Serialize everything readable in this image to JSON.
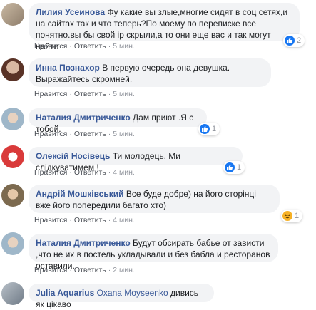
{
  "actions": {
    "like": "Нравится",
    "reply": "Ответить",
    "sep": "·"
  },
  "comments": [
    {
      "author": "Лилия Усеинова",
      "text": "Фу какие вы злые,многие сидят в соц сетях,и на сайтах так и что теперь?По моему по переписке все понятно.вы бы свой ip скрыли,а то они еще вас и так могут найти",
      "time": "5 мин.",
      "reaction": {
        "type": "like",
        "count": "2"
      }
    },
    {
      "author": "Инна Познахор",
      "text": "В первую очередь она девушка. Выражайтесь скромней.",
      "time": "5 мин."
    },
    {
      "author": "Наталия Дмитриченко",
      "text": "Дам приют .Я с тобой.",
      "time": "5 мин.",
      "reaction": {
        "type": "like",
        "count": "1"
      }
    },
    {
      "author": "Олексій Носівець",
      "text": "Ти молодець. Ми слідкуватимем !",
      "time": "4 мин.",
      "reaction": {
        "type": "like",
        "count": "1"
      }
    },
    {
      "author": "Андрій Мошківський",
      "text": "Все буде добре) на його сторінці вже його попередили багато хто)",
      "time": "4 мин.",
      "reaction": {
        "type": "haha",
        "count": "1"
      }
    },
    {
      "author": "Наталия Дмитриченко",
      "text": "Будут обсирать бабье от зависти ,что не их в постель укладывали и без бабла и ресторанов оставили.",
      "time": "2 мин."
    },
    {
      "author": "Julia Aquarius",
      "mention": "Oxana Moyseenko",
      "text": "дивись як цікаво",
      "time": ""
    }
  ],
  "colors": {
    "link": "#385898",
    "bubble": "#f2f3f5",
    "meta": "#90949c",
    "like": "#1877f2",
    "haha": "#f7b125"
  }
}
